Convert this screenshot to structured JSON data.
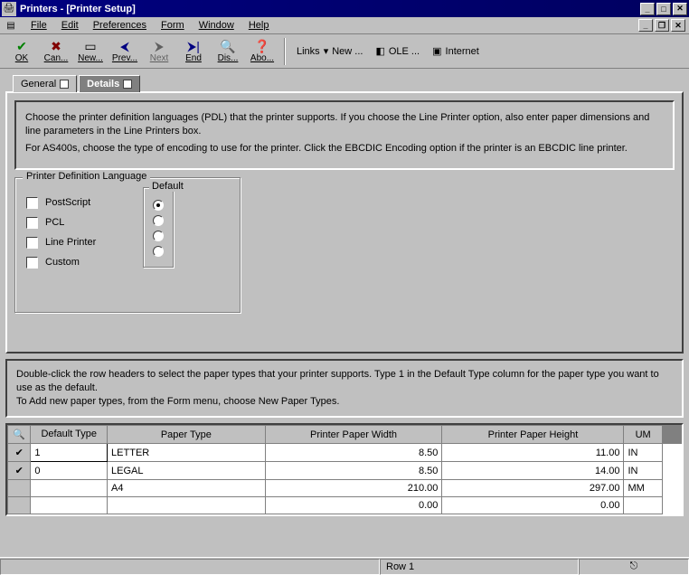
{
  "window": {
    "title": "Printers - [Printer Setup]"
  },
  "menu": {
    "file": "File",
    "edit": "Edit",
    "preferences": "Preferences",
    "form": "Form",
    "window": "Window",
    "help": "Help"
  },
  "toolbar": {
    "ok": "OK",
    "cancel": "Can...",
    "new": "New...",
    "prev": "Prev...",
    "next": "Next",
    "end": "End",
    "dis": "Dis...",
    "abo": "Abo...",
    "links": "Links",
    "links_new": "New ...",
    "ole": "OLE ...",
    "internet": "Internet"
  },
  "tabs": {
    "general": "General",
    "details": "Details"
  },
  "details": {
    "instr1": "Choose the printer definition languages (PDL) that the printer supports. If you choose the Line Printer option, also enter paper dimensions and line parameters in the Line Printers box.",
    "instr2": "For AS400s, choose the type of encoding to use for the printer. Click the EBCDIC Encoding option if the printer is an EBCDIC line printer.",
    "pdl_legend": "Printer Definition Language",
    "default_legend": "Default",
    "options": {
      "postscript": "PostScript",
      "pcl": "PCL",
      "lineprinter": "Line Printer",
      "custom": "Custom"
    },
    "default_selected": 0
  },
  "paper": {
    "instr1": "Double-click the row headers to select the paper types that your printer supports.  Type 1 in the Default Type column for the paper type you want to use as the default.",
    "instr2": "To Add new paper types, from the Form menu, choose New Paper Types.",
    "columns": {
      "rowicon": "",
      "default_type": "Default Type",
      "paper_type": "Paper Type",
      "width": "Printer Paper Width",
      "height": "Printer Paper Height",
      "um": "UM"
    },
    "rows": [
      {
        "sel": true,
        "default_type": "1",
        "paper_type": "LETTER",
        "width": "8.50",
        "height": "11.00",
        "um": "IN"
      },
      {
        "sel": true,
        "default_type": "0",
        "paper_type": "LEGAL",
        "width": "8.50",
        "height": "14.00",
        "um": "IN"
      },
      {
        "sel": false,
        "default_type": "",
        "paper_type": "A4",
        "width": "210.00",
        "height": "297.00",
        "um": "MM"
      },
      {
        "sel": false,
        "default_type": "",
        "paper_type": "",
        "width": "0.00",
        "height": "0.00",
        "um": ""
      }
    ]
  },
  "statusbar": {
    "row": "Row 1"
  }
}
